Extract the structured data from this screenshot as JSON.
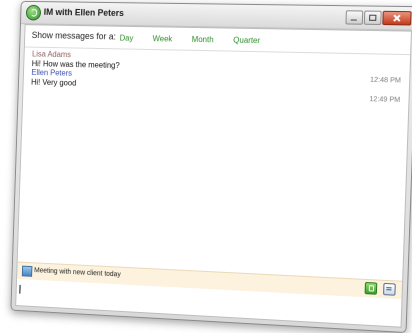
{
  "window": {
    "title": "IM with Ellen Peters"
  },
  "filter": {
    "label": "Show messages for a:",
    "options": [
      "Day",
      "Week",
      "Month",
      "Quarter"
    ]
  },
  "messages": [
    {
      "sender": "Lisa Adams",
      "text": "Hi! How was the meeting?",
      "time": "12:48 PM"
    },
    {
      "sender": "Ellen Peters",
      "text": "Hi! Very good",
      "time": "12:49 PM"
    }
  ],
  "status": {
    "text": "Meeting with new client today"
  },
  "input": {
    "value": ""
  },
  "icons": {
    "app": "chat-app-icon",
    "status": "note-icon",
    "attach": "attach-file-icon",
    "history": "history-icon"
  },
  "colors": {
    "link_green": "#2e8b2a",
    "other_sender": "#8c5f5f",
    "self_sender": "#3b4db4",
    "status_bg": "#fcf2dd",
    "close_red": "#c43a1c"
  }
}
